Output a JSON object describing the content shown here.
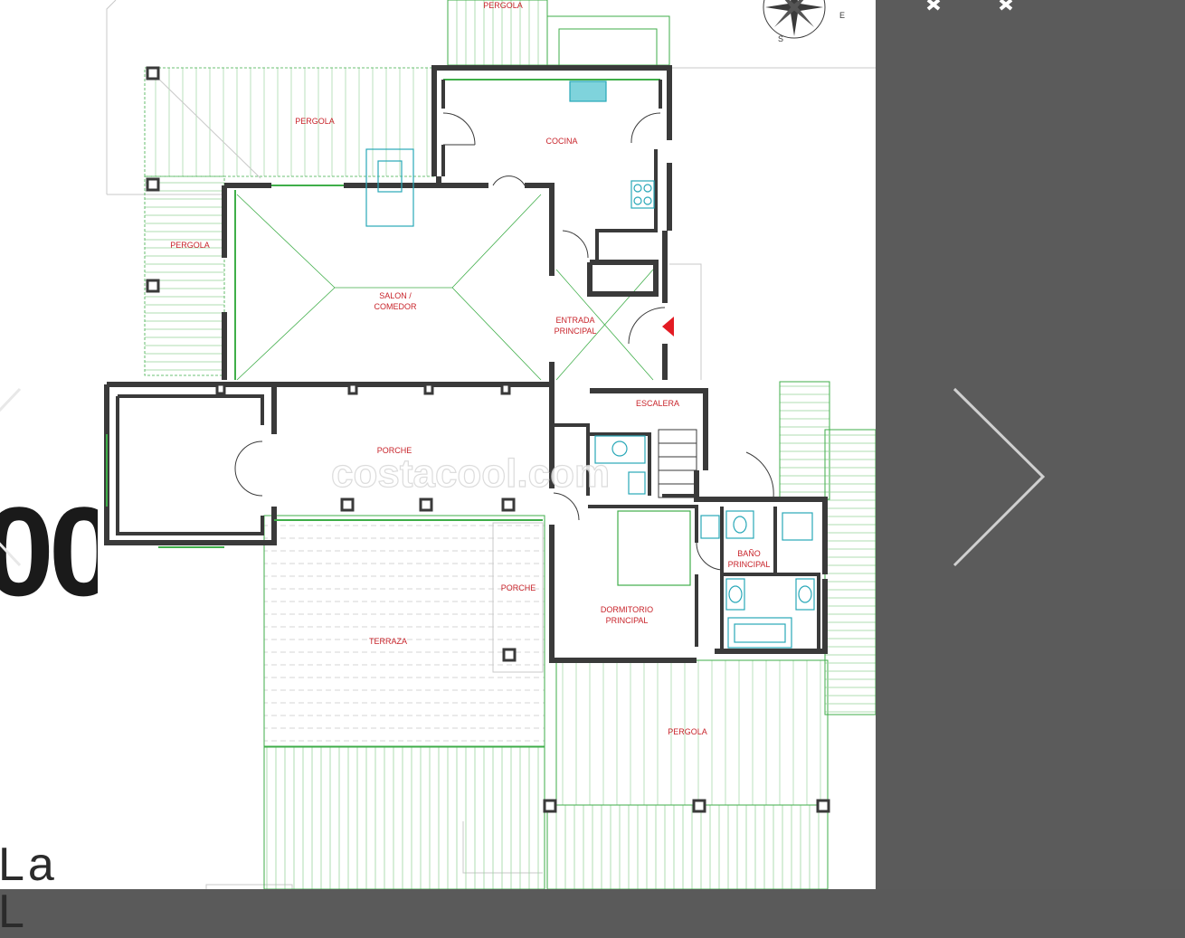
{
  "background": {
    "price_fragment": "00",
    "title_fragment": "La L"
  },
  "floor_plan": {
    "watermark": "costacool.com",
    "compass": {
      "south": "S",
      "east": "E"
    },
    "rooms": {
      "pergola_top": "PERGOLA",
      "pergola_upper": "PERGOLA",
      "pergola_left": "PERGOLA",
      "cocina": "COCINA",
      "salon_1": "SALON /",
      "salon_2": "COMEDOR",
      "entrada_1": "ENTRADA",
      "entrada_2": "PRINCIPAL",
      "escalera": "ESCALERA",
      "porche_main": "PORCHE",
      "porche_side": "PORCHE",
      "terraza": "TERRAZA",
      "bano_1": "BAÑO",
      "bano_2": "PRINCIPAL",
      "dormitorio_1": "DORMITORIO",
      "dormitorio_2": "PRINCIPAL",
      "pergola_bottom": "PERGOLA"
    }
  },
  "colors": {
    "wall": "#3a3a3a",
    "plan_line": "#3fae49",
    "label": "#c8242b",
    "fixture": "#28a8b8",
    "entrance_marker": "#e31b23"
  }
}
